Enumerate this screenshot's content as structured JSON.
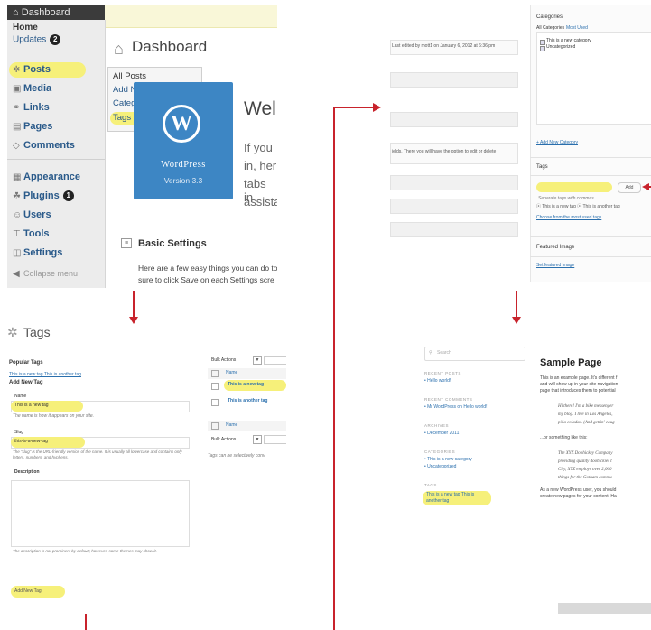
{
  "panel1": {
    "admin_bar": "Dashboard",
    "home": "Home",
    "updates": "Updates",
    "updates_count": "2",
    "menu": [
      {
        "label": "Posts",
        "icon": "pin-icon"
      },
      {
        "label": "Media",
        "icon": "media-icon"
      },
      {
        "label": "Links",
        "icon": "link-icon"
      },
      {
        "label": "Pages",
        "icon": "pages-icon"
      },
      {
        "label": "Comments",
        "icon": "comments-icon"
      },
      {
        "label": "Appearance",
        "icon": "appearance-icon"
      },
      {
        "label": "Plugins",
        "icon": "plugins-icon",
        "badge": "1"
      },
      {
        "label": "Users",
        "icon": "users-icon"
      },
      {
        "label": "Tools",
        "icon": "tools-icon"
      },
      {
        "label": "Settings",
        "icon": "settings-icon"
      },
      {
        "label": "Collapse menu",
        "icon": "collapse-icon"
      }
    ],
    "flyout": [
      "All Posts",
      "Add New",
      "Categories",
      "Tags"
    ],
    "title": "Dashboard",
    "wp_name": "WordPress",
    "wp_version": "Version 3.3",
    "welcome": "Wel",
    "welcome_lines": [
      "If you",
      "in, her",
      "tabs in",
      "assista"
    ],
    "basic_settings": "Basic Settings",
    "basic_text": [
      "Here are a few easy things you can do to",
      "sure to click Save on each Settings scre"
    ]
  },
  "panel2": {
    "title": "Tags",
    "popular_tags": "Popular Tags",
    "popular_list": "This is a new tag  This is another tag",
    "add_new_tag": "Add New Tag",
    "name_label": "Name",
    "name_value": "This is a new tag",
    "name_hint": "The name is how it appears on your site.",
    "slug_label": "Slug",
    "slug_value": "this-is-a-new-tag",
    "slug_hint": "The “slug” is the URL-friendly version of the name. It is usually all lowercase and contains only letters, numbers, and hyphens.",
    "description_label": "Description",
    "description_hint": "The description is not prominent by default; however, some themes may show it.",
    "add_button": "Add New Tag",
    "bulk_actions": "Bulk Actions",
    "col_name": "Name",
    "rows": [
      "This is a new tag",
      "This is another tag"
    ],
    "footer_note": "Tags can be selectively conv"
  },
  "panel3": {
    "categories": "Categories",
    "tab_all": "All Categories",
    "tab_most": "Most Used",
    "cats": [
      "This is a new category",
      "Uncategorized"
    ],
    "last_edited": "Last edited by mott1 on January 6, 2012 at 6:36 pm",
    "strip_text": "ields. There you will have the option to edit or delete",
    "add_category": "+ Add New Category",
    "tags_title": "Tags",
    "add_btn": "Add",
    "separate": "Separate tags with commas",
    "tag_chips": "ⓧ This is a new tag  ⓧ This is another tag",
    "choose_used": "Choose from the most used tags",
    "featured_image": "Featured Image",
    "set_featured": "Set featured image"
  },
  "panel4": {
    "search": "Search",
    "recent_posts": "RECENT POSTS",
    "hello_world": "Hello world!",
    "recent_comments": "RECENT COMMENTS",
    "comment_line": "Mr WordPress on Hello world!",
    "archives": "ARCHIVES",
    "archive_item": "December 2011",
    "categories": "CATEGORIES",
    "cat_items": [
      "This is a new category",
      "Uncategorized"
    ],
    "tags": "TAGS",
    "tags_list": "This is a new tag  This is another tag",
    "page_title": "Sample Page",
    "intro": [
      "This is an example page. It's different f",
      "and will show up in your site navigation",
      "page that introduces them to potential"
    ],
    "quote1": [
      "Hi there! I'm a bike messenger",
      "my blog. I live in Los Angeles,",
      "piña coladas. (And gettin' caug"
    ],
    "or_like": "...or something like this:",
    "quote2": [
      "The XYZ Doohickey Company",
      "providing quality doohickies t",
      "City, XYZ employs over 2,000",
      "things for the Gotham commu"
    ],
    "outro": [
      "As a new WordPress user, you should",
      "create new pages for your content. Ha"
    ]
  },
  "colors": {
    "highlight": "#f6f07a",
    "arrow": "#c8232c",
    "wp_blue": "#3d86c4"
  }
}
